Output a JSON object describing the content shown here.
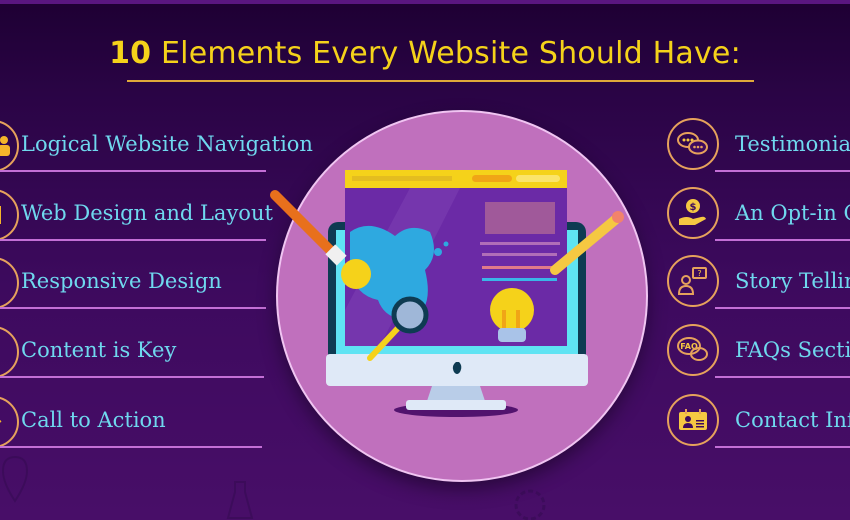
{
  "title": {
    "number": "10",
    "text": " Elements Every Website Should Have:"
  },
  "left_items": [
    {
      "label": "Logical Website Navigation",
      "icon": "user-icon"
    },
    {
      "label": "Web Design and Layout",
      "icon": "layout-icon"
    },
    {
      "label": "Responsive Design",
      "icon": "devices-icon"
    },
    {
      "label": "Content is Key",
      "icon": "document-icon"
    },
    {
      "label": "Call to Action",
      "icon": "cursor-icon"
    }
  ],
  "right_items": [
    {
      "label": "Testimonials",
      "icon": "chat-bubbles-icon"
    },
    {
      "label": "An Opt-in C",
      "icon": "hand-dollar-icon"
    },
    {
      "label": "Story Tellin",
      "icon": "person-question-icon"
    },
    {
      "label": "FAQs Sectio",
      "icon": "faq-bubbles-icon"
    },
    {
      "label": "Contact Inf",
      "icon": "id-card-icon"
    }
  ],
  "illustration": {
    "faq_text": "FAQ",
    "dollar_text": "$",
    "question_text": "?"
  },
  "colors": {
    "title": "#f5d21a",
    "label": "#6fd8ee",
    "rule": "#c36fd6",
    "ring": "#e6a25c",
    "circle": "#c070bd",
    "background": "#3d0a5e"
  }
}
